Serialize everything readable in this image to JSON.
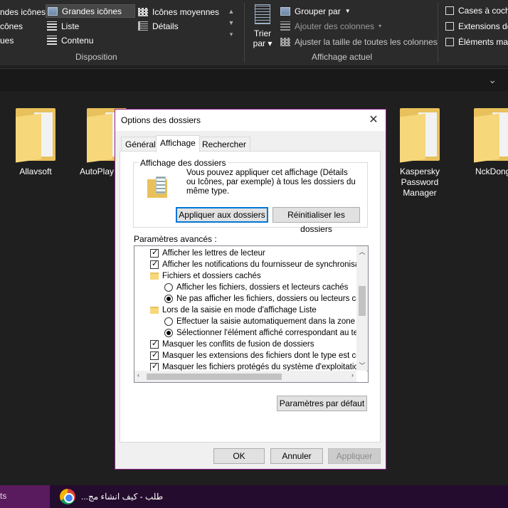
{
  "ribbon": {
    "layout": {
      "items": [
        "ndes icônes",
        "Grandes icônes",
        "Icônes moyennes",
        "cônes",
        "Liste",
        "Détails",
        "ues",
        "Contenu"
      ],
      "group_label": "Disposition"
    },
    "sort": {
      "label_line1": "Trier",
      "label_line2": "par"
    },
    "current_view": {
      "items": [
        "Grouper par",
        "Ajouter des colonnes",
        "Ajuster la taille de toutes les colonnes"
      ],
      "group_label": "Affichage actuel"
    },
    "show_hide": {
      "items": [
        "Cases à coche",
        "Extensions de",
        "Éléments mas"
      ]
    }
  },
  "folders": [
    "Allavsoft",
    "AutoPlay Stud",
    "Kaspersky Password Manager",
    "NckDong"
  ],
  "taskbar": {
    "left_label": "ts",
    "chrome_title": "طلب - كيف انشاء مج..."
  },
  "dialog": {
    "title": "Options des dossiers",
    "tabs": [
      "Général",
      "Affichage",
      "Rechercher"
    ],
    "folder_views": {
      "legend": "Affichage des dossiers",
      "description": "Vous pouvez appliquer cet affichage (Détails ou Icônes, par exemple) à tous les dossiers du même type.",
      "apply_button": "Appliquer aux dossiers",
      "reset_button": "Réinitialiser les dossiers"
    },
    "advanced_label": "Paramètres avancés :",
    "advanced_items": [
      {
        "kind": "checkbox",
        "checked": true,
        "label": "Afficher les lettres de lecteur"
      },
      {
        "kind": "checkbox",
        "checked": true,
        "label": "Afficher les notifications du fournisseur de synchronisation"
      },
      {
        "kind": "folder",
        "label": "Fichiers et dossiers cachés"
      },
      {
        "kind": "radio",
        "checked": false,
        "label": "Afficher les fichiers, dossiers et lecteurs cachés"
      },
      {
        "kind": "radio",
        "checked": true,
        "label": "Ne pas afficher les fichiers, dossiers ou lecteurs cachés"
      },
      {
        "kind": "folder",
        "label": "Lors de la saisie en mode d'affichage Liste"
      },
      {
        "kind": "radio",
        "checked": false,
        "label": "Effectuer la saisie automatiquement dans la zone Rech"
      },
      {
        "kind": "radio",
        "checked": true,
        "label": "Sélectionner l'élément affiché correspondant au texte"
      },
      {
        "kind": "checkbox",
        "checked": true,
        "label": "Masquer les conflits de fusion de dossiers"
      },
      {
        "kind": "checkbox",
        "checked": true,
        "label": "Masquer les extensions des fichiers dont le type est connu"
      },
      {
        "kind": "checkbox",
        "checked": true,
        "label": "Masquer les fichiers protégés du système d'exploitation (re"
      }
    ],
    "defaults_button": "Paramètres par défaut",
    "ok_button": "OK",
    "cancel_button": "Annuler",
    "apply_button": "Appliquer"
  },
  "colors": {
    "dialog_border": "#8e1e8a",
    "taskbar": "#240c2e",
    "explorer_bg": "#1f1f1f",
    "folder": "#e8c15c"
  }
}
